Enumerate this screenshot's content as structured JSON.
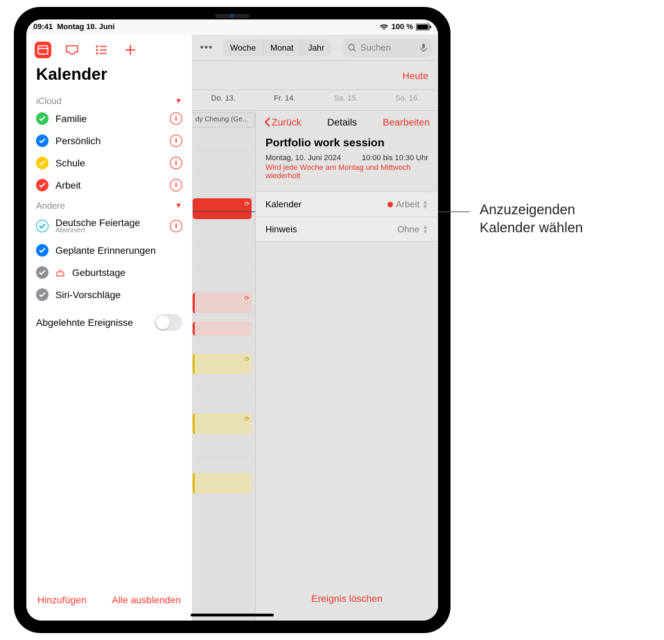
{
  "status": {
    "time": "09:41",
    "date": "Montag 10. Juni",
    "battery": "100 %"
  },
  "sidebar": {
    "title": "Kalender",
    "sections": {
      "icloud": {
        "label": "iCloud",
        "items": [
          {
            "label": "Familie",
            "color": "#34c759"
          },
          {
            "label": "Persönlich",
            "color": "#007aff"
          },
          {
            "label": "Schule",
            "color": "#ffcc00"
          },
          {
            "label": "Arbeit",
            "color": "#ff3b30"
          }
        ]
      },
      "other": {
        "label": "Andere",
        "items": [
          {
            "label": "Deutsche Feiertage",
            "sub": "Abonniert",
            "color": "#00b0c7",
            "outline": true,
            "info": true
          },
          {
            "label": "Geplante Erinnerungen",
            "color": "#007aff"
          },
          {
            "label": "Geburtstage",
            "color": "#8e8e93",
            "cake": true
          },
          {
            "label": "Siri-Vorschläge",
            "color": "#8e8e93"
          }
        ]
      }
    },
    "declined": "Abgelehnte Ereignisse",
    "footer": {
      "add": "Hinzufügen",
      "hide": "Alle ausblenden"
    }
  },
  "toolbar": {
    "seg": {
      "week": "Woche",
      "month": "Monat",
      "year": "Jahr"
    },
    "search_placeholder": "Suchen",
    "today": "Heute"
  },
  "days": {
    "d1": "Do. 13.",
    "d2": "Fr. 14.",
    "d3": "Sa. 15.",
    "d4": "So. 16."
  },
  "event_peek": "dy Cheung (Ge...",
  "detail": {
    "back": "Zurück",
    "title": "Details",
    "edit": "Bearbeiten",
    "event_title": "Portfolio work session",
    "date": "Montag, 10. Juni 2024",
    "time": "10:00 bis 10:30 Uhr",
    "repeat": "Wird jede Woche am Montag und Mittwoch wiederholt",
    "calendar_label": "Kalender",
    "calendar_value": "Arbeit",
    "alert_label": "Hinweis",
    "alert_value": "Ohne",
    "delete": "Ereignis löschen"
  },
  "callout": {
    "line1": "Anzuzeigenden",
    "line2": "Kalender wählen"
  }
}
